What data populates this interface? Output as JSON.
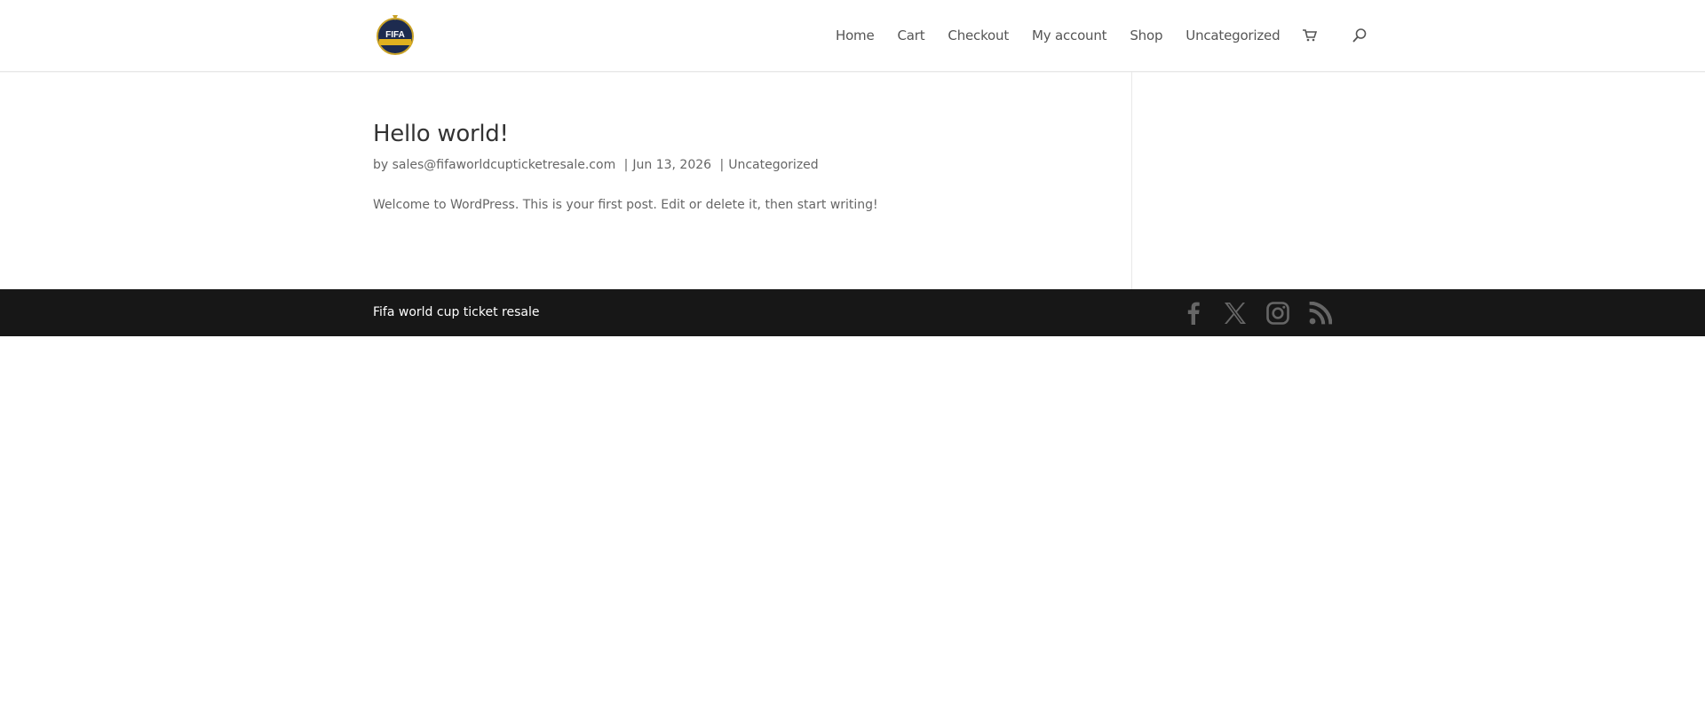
{
  "header": {
    "logo_alt": "FIFA",
    "nav": [
      {
        "label": "Home"
      },
      {
        "label": "Cart"
      },
      {
        "label": "Checkout"
      },
      {
        "label": "My account"
      },
      {
        "label": "Shop"
      },
      {
        "label": "Uncategorized"
      }
    ],
    "icons": [
      "cart-icon",
      "search-icon"
    ]
  },
  "post": {
    "title": "Hello world!",
    "meta_prefix": "by",
    "author": "sales@fifaworldcupticketresale.com",
    "separator": "|",
    "date": "Jun 13, 2026",
    "category": "Uncategorized",
    "excerpt": "Welcome to WordPress. This is your first post. Edit or delete it, then start writing!"
  },
  "footer": {
    "text": "Fifa world cup ticket resale",
    "social_icons": [
      "facebook-icon",
      "x-icon",
      "instagram-icon",
      "rss-icon"
    ]
  },
  "colors": {
    "footer_bg": "#171717",
    "text": "#666666",
    "title": "#333333"
  }
}
